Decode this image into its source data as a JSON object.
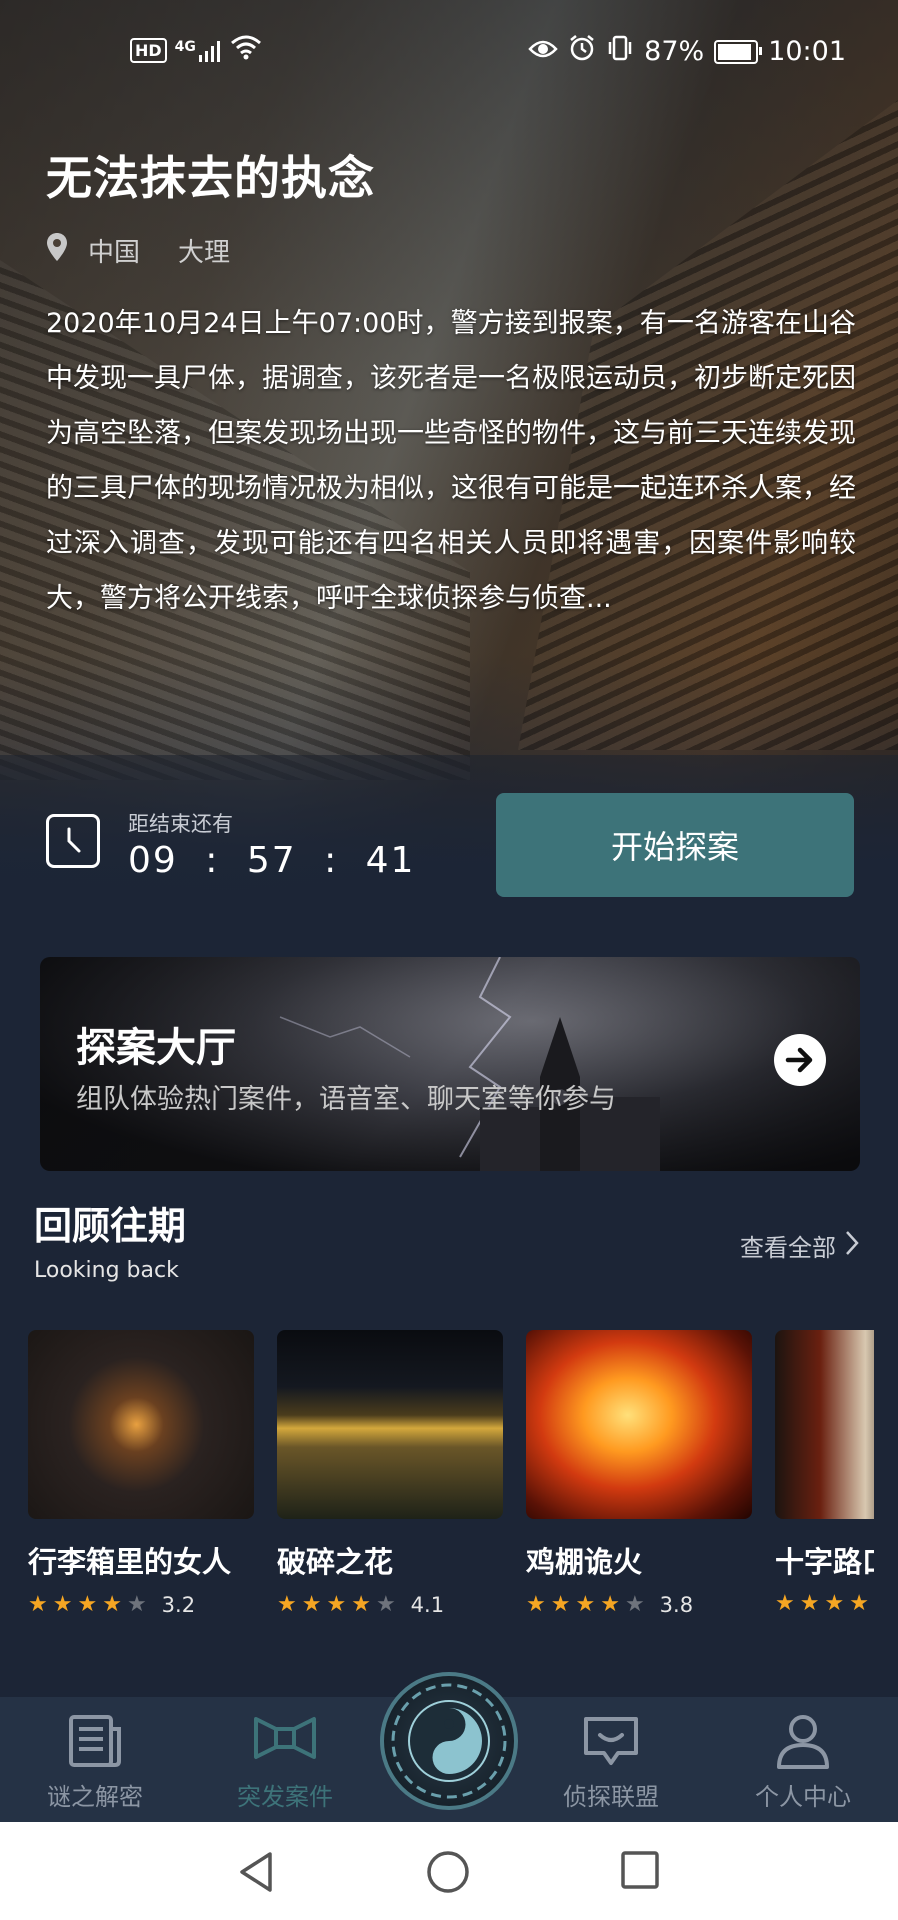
{
  "status_bar": {
    "left_icons": [
      "hd-badge",
      "4g-signal-icon",
      "wifi-icon"
    ],
    "hd_label": "HD",
    "network_label": "4G",
    "battery_percent": "87%",
    "time": "10:01",
    "battery_level": 0.87
  },
  "hero": {
    "title": "无法抹去的执念",
    "location": {
      "country": "中国",
      "city": "大理"
    },
    "description": "2020年10月24日上午07:00时，警方接到报案，有一名游客在山谷中发现一具尸体，据调查，该死者是一名极限运动员，初步断定死因为高空坠落，但案发现场出现一些奇怪的物件，这与前三天连续发现的三具尸体的现场情况极为相似，这很有可能是一起连环杀人案，经过深入调查，发现可能还有四名相关人员即将遇害，因案件影响较大，警方将公开线索，呼吁全球侦探参与侦查..."
  },
  "timer": {
    "label": "距结束还有",
    "value": "09 : 57 : 41"
  },
  "start_button": {
    "label": "开始探案"
  },
  "hall": {
    "title": "探案大厅",
    "subtitle": "组队体验热门案件，语音室、聊天室等你参与"
  },
  "review": {
    "title": "回顾往期",
    "subtitle": "Looking back",
    "view_all": "查看全部",
    "cards": [
      {
        "name": "行李箱里的女人",
        "rating": "3.2",
        "stars": 4
      },
      {
        "name": "破碎之花",
        "rating": "4.1",
        "stars": 4
      },
      {
        "name": "鸡棚诡火",
        "rating": "3.8",
        "stars": 4
      },
      {
        "name": "十字路口",
        "rating": "",
        "stars": 4
      }
    ]
  },
  "bottom_nav": {
    "items": [
      {
        "label": "谜之解密",
        "icon": "newspaper-icon"
      },
      {
        "label": "突发案件",
        "icon": "bowtie-icon"
      },
      {
        "label": "侦探联盟",
        "icon": "chat-bubble-icon"
      },
      {
        "label": "个人中心",
        "icon": "person-icon"
      }
    ],
    "active_index": 1,
    "center_icon": "taiji-emblem-icon"
  },
  "colors": {
    "accent": "#3d7379",
    "background": "#1c2536",
    "nav_background": "#253245",
    "star": "#f5a623"
  }
}
